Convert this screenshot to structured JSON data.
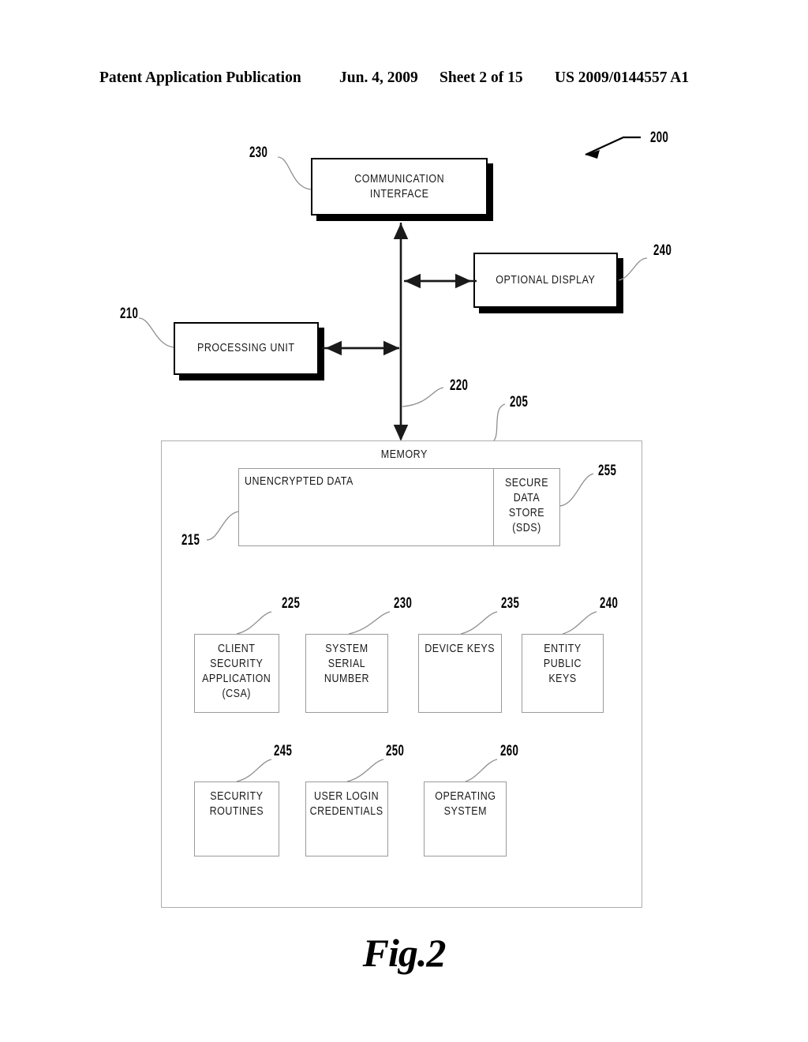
{
  "header": {
    "title": "Patent Application Publication",
    "date": "Jun. 4, 2009",
    "sheet": "Sheet 2 of 15",
    "publication_number": "US 2009/0144557 A1"
  },
  "figure": {
    "caption": "Fig.2",
    "system_ref": "200"
  },
  "blocks": {
    "communication_interface": {
      "label": "COMMUNICATION\nINTERFACE",
      "line1": "COMMUNICATION",
      "line2": "INTERFACE",
      "ref": "230"
    },
    "optional_display": {
      "label": "OPTIONAL DISPLAY",
      "ref": "240"
    },
    "processing_unit": {
      "label": "PROCESSING UNIT",
      "ref": "210"
    },
    "bus": {
      "ref": "220"
    },
    "memory": {
      "label": "MEMORY",
      "ref": "205"
    },
    "unencrypted_data": {
      "label": "UNENCRYPTED DATA",
      "ref": "215"
    },
    "secure_data_store": {
      "line1": "SECURE",
      "line2": "DATA STORE",
      "line3": "(SDS)",
      "ref": "255"
    }
  },
  "memory_items_row1": [
    {
      "name": "client-security-application",
      "lines": [
        "CLIENT",
        "SECURITY",
        "APPLICATION",
        "(CSA)"
      ],
      "ref": "225"
    },
    {
      "name": "system-serial-number",
      "lines": [
        "SYSTEM SERIAL",
        "NUMBER"
      ],
      "ref": "230"
    },
    {
      "name": "device-keys",
      "lines": [
        "DEVICE KEYS"
      ],
      "ref": "235"
    },
    {
      "name": "entity-public-keys",
      "lines": [
        "ENTITY PUBLIC",
        "KEYS"
      ],
      "ref": "240"
    }
  ],
  "memory_items_row2": [
    {
      "name": "security-routines",
      "lines": [
        "SECURITY",
        "ROUTINES"
      ],
      "ref": "245"
    },
    {
      "name": "user-login-credentials",
      "lines": [
        "USER LOGIN",
        "CREDENTIALS"
      ],
      "ref": "250"
    },
    {
      "name": "operating-system",
      "lines": [
        "OPERATING",
        "SYSTEM"
      ],
      "ref": "260"
    }
  ],
  "colors": {
    "ink": "#000000",
    "thin_line": "#9a9a9a",
    "paper": "#ffffff"
  }
}
